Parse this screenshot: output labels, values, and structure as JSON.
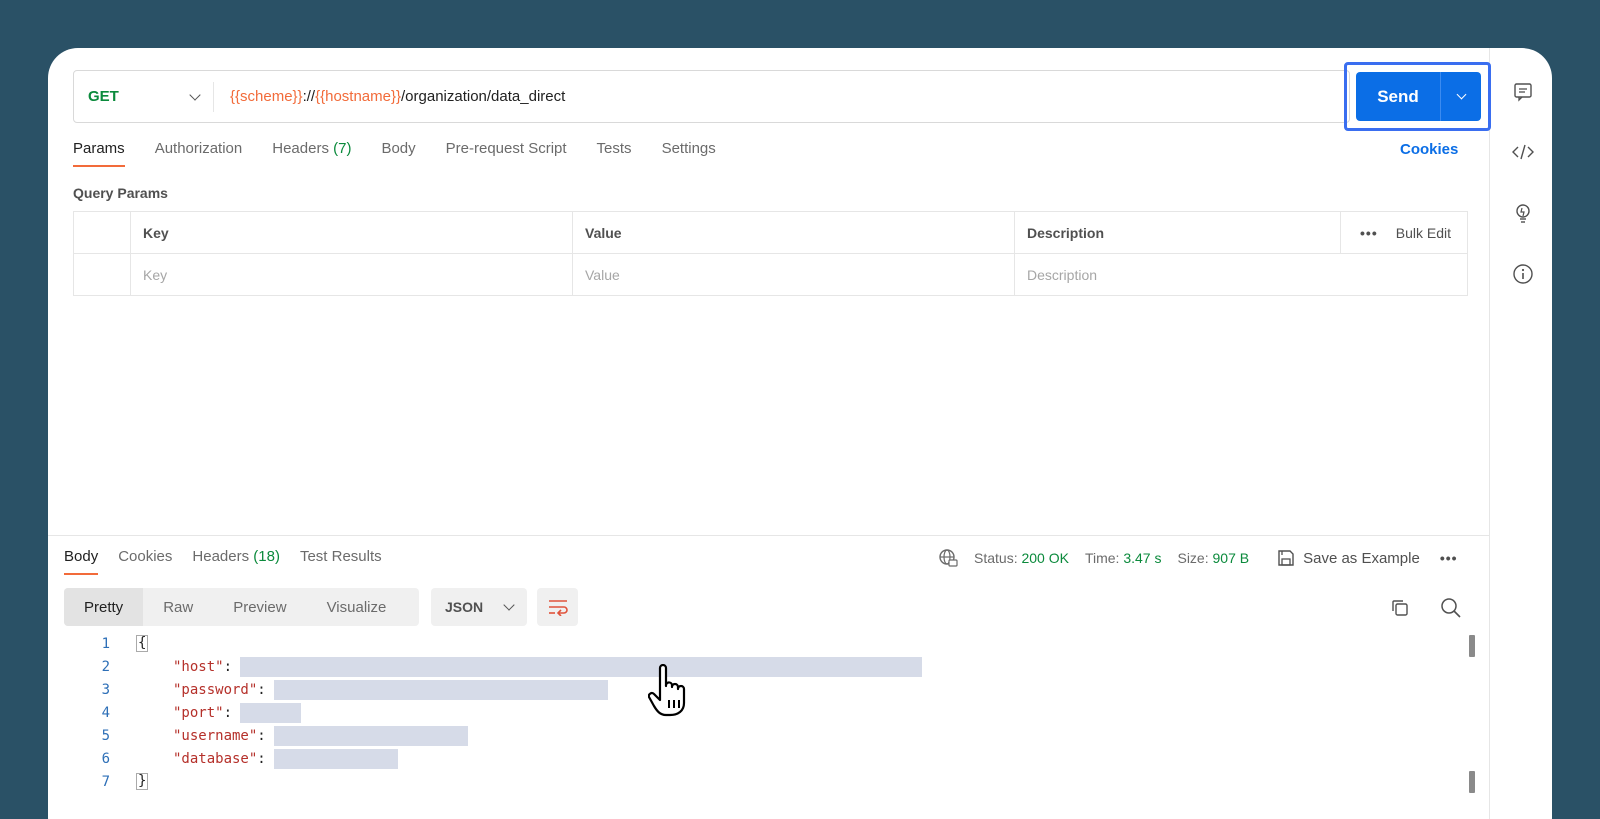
{
  "request": {
    "method": "GET",
    "url_parts": [
      {
        "text": "{{scheme}}",
        "var": true
      },
      {
        "text": "://",
        "var": false
      },
      {
        "text": "{{hostname}}",
        "var": true
      },
      {
        "text": "/organization/data_direct",
        "var": false
      }
    ],
    "send_label": "Send"
  },
  "request_tabs": [
    {
      "label": "Params",
      "count": "",
      "active": true
    },
    {
      "label": "Authorization",
      "count": "",
      "active": false
    },
    {
      "label": "Headers",
      "count": "(7)",
      "active": false
    },
    {
      "label": "Body",
      "count": "",
      "active": false
    },
    {
      "label": "Pre-request Script",
      "count": "",
      "active": false
    },
    {
      "label": "Tests",
      "count": "",
      "active": false
    },
    {
      "label": "Settings",
      "count": "",
      "active": false
    }
  ],
  "cookies_link": "Cookies",
  "query_params": {
    "title": "Query Params",
    "headers": {
      "key": "Key",
      "value": "Value",
      "description": "Description",
      "bulk_edit": "Bulk Edit"
    },
    "placeholder": {
      "key": "Key",
      "value": "Value",
      "description": "Description"
    }
  },
  "response_tabs": [
    {
      "label": "Body",
      "count": "",
      "active": true
    },
    {
      "label": "Cookies",
      "count": "",
      "active": false
    },
    {
      "label": "Headers",
      "count": "(18)",
      "active": false
    },
    {
      "label": "Test Results",
      "count": "",
      "active": false
    }
  ],
  "status": {
    "status_label": "Status:",
    "status_value": "200 OK",
    "time_label": "Time:",
    "time_value": "3.47 s",
    "size_label": "Size:",
    "size_value": "907 B",
    "save_example": "Save as Example"
  },
  "view_modes": [
    "Pretty",
    "Raw",
    "Preview",
    "Visualize"
  ],
  "active_view_mode": "Pretty",
  "format": "JSON",
  "code_lines": [
    {
      "n": "1",
      "brace": "{"
    },
    {
      "n": "2",
      "key": "\"host\"",
      "masked": true
    },
    {
      "n": "3",
      "key": "\"password\"",
      "masked": true
    },
    {
      "n": "4",
      "key": "\"port\"",
      "masked": true
    },
    {
      "n": "5",
      "key": "\"username\"",
      "masked": true
    },
    {
      "n": "6",
      "key": "\"database\"",
      "masked": true
    },
    {
      "n": "7",
      "brace": "}"
    }
  ],
  "colors": {
    "accent": "#0b6ee6",
    "method": "#0b8a3c",
    "variable": "#f26b3a",
    "highlight": "#3a6ef0"
  }
}
